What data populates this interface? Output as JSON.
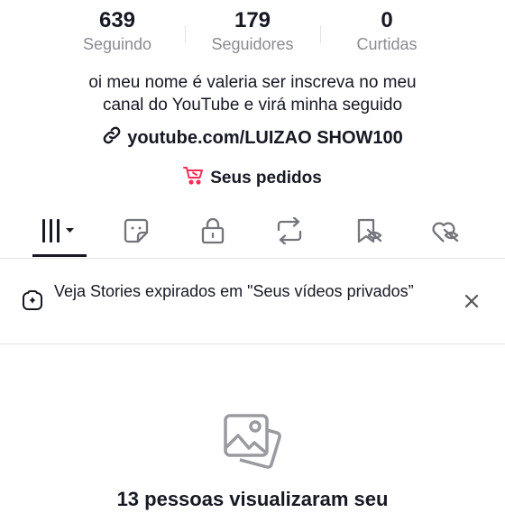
{
  "stats": [
    {
      "value": "639",
      "label": "Seguindo"
    },
    {
      "value": "179",
      "label": "Seguidores"
    },
    {
      "value": "0",
      "label": "Curtidas"
    }
  ],
  "bio": {
    "line1": "oi meu nome é valeria ser inscreva no meu",
    "line2": "canal do YouTube e virá minha seguido"
  },
  "link": {
    "text": "youtube.com/LUIZAO SHOW100",
    "icon": "link-icon"
  },
  "orders": {
    "text": "Seus pedidos",
    "icon": "cart-icon",
    "icon_color": "#fe2c55"
  },
  "tabs": [
    {
      "icon": "grid-videos-icon",
      "selected": true
    },
    {
      "icon": "sticker-icon"
    },
    {
      "icon": "lock-icon"
    },
    {
      "icon": "repost-icon"
    },
    {
      "icon": "bookmark-hidden-icon"
    },
    {
      "icon": "liked-hidden-icon"
    }
  ],
  "banner": {
    "text": "Veja Stories expirados em \"Seus vídeos privados”",
    "icon": "add-story-icon",
    "close_icon": "close-icon"
  },
  "empty_state": {
    "icon": "photo-stack-icon",
    "title": "13 pessoas visualizaram seu"
  },
  "colors": {
    "text": "#161823",
    "secondary": "#8a8b91",
    "accent": "#fe2c55",
    "divider": "#e3e3e4"
  }
}
